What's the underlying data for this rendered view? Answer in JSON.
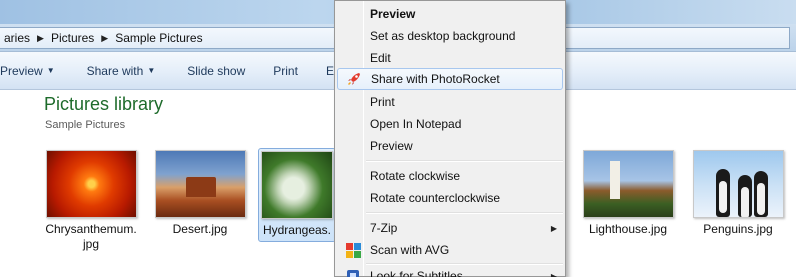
{
  "address": {
    "crumbs": [
      "aries",
      "Pictures",
      "Sample Pictures"
    ]
  },
  "toolbar": {
    "preview": "Preview",
    "share_with": "Share with",
    "slide_show": "Slide show",
    "print": "Print",
    "email": "E-"
  },
  "library": {
    "title": "Pictures library",
    "subtitle": "Sample Pictures"
  },
  "files": [
    {
      "caption": "Chrysanthemum.\njpg"
    },
    {
      "caption": "Desert.jpg"
    },
    {
      "caption": "Hydrangeas."
    },
    {
      "caption": "Lighthouse.jpg"
    },
    {
      "caption": "Penguins.jpg"
    }
  ],
  "menu": {
    "items": [
      {
        "label": "Preview"
      },
      {
        "label": "Set as desktop background"
      },
      {
        "label": "Edit"
      },
      {
        "label": "Share with PhotoRocket"
      },
      {
        "label": "Print"
      },
      {
        "label": "Open In Notepad"
      },
      {
        "label": "Preview"
      },
      {
        "label": "Rotate clockwise"
      },
      {
        "label": "Rotate counterclockwise"
      },
      {
        "label": "7-Zip"
      },
      {
        "label": "Scan with AVG"
      },
      {
        "label": "Look for Subtitles"
      }
    ]
  },
  "colors": {
    "library_title": "#1e6b2b",
    "menu_hover_border": "#a8c7ee",
    "toolbar_text": "#1e395b"
  },
  "icons": {
    "rocket": "photorocket-icon",
    "avg": "avg-icon",
    "subtitles": "subtitles-icon"
  }
}
